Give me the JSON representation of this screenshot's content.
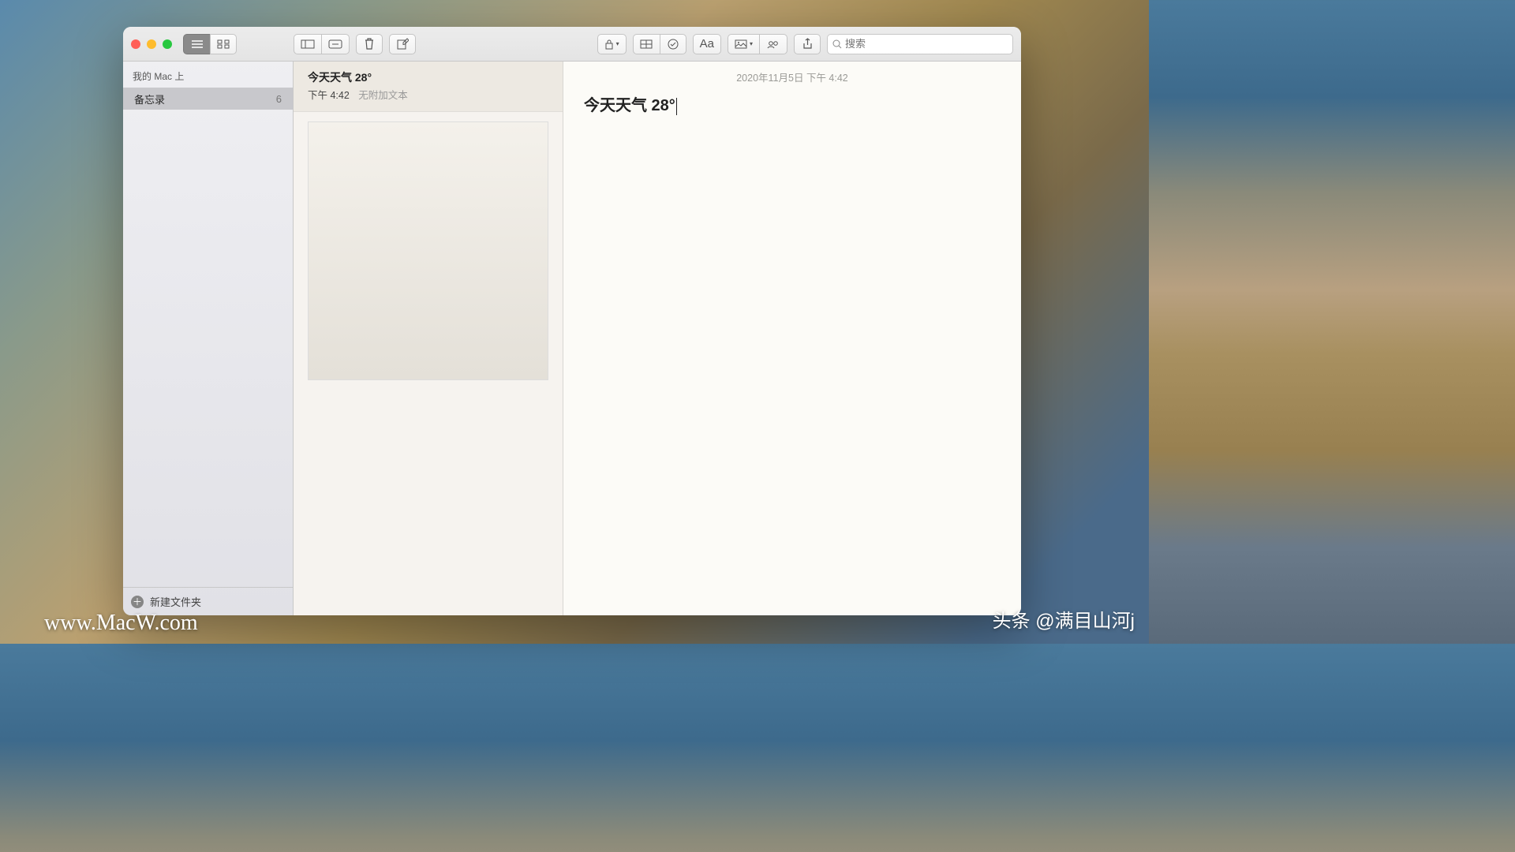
{
  "search": {
    "placeholder": "搜索"
  },
  "sidebar": {
    "header": "我的 Mac 上",
    "items": [
      {
        "label": "备忘录",
        "count": "6"
      }
    ],
    "new_folder_label": "新建文件夹"
  },
  "notes_list": {
    "items": [
      {
        "title": "今天天气 28°",
        "time": "下午 4:42",
        "preview": "无附加文本"
      }
    ]
  },
  "editor": {
    "timestamp": "2020年11月5日 下午 4:42",
    "title": "今天天气 28°"
  },
  "watermarks": {
    "site": "www.MacW.com",
    "author": "头条 @满目山河j"
  }
}
